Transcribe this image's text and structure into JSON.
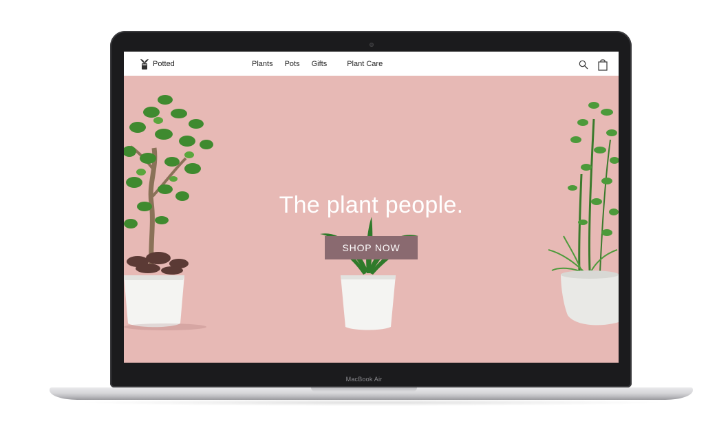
{
  "device": {
    "label": "MacBook Air"
  },
  "site": {
    "brand": "Potted",
    "nav": {
      "items": [
        "Plants",
        "Pots",
        "Gifts",
        "Plant Care"
      ]
    },
    "icons": {
      "search": "search-icon",
      "cart": "shopping-bag-icon"
    },
    "hero": {
      "title": "The plant people.",
      "cta_label": "SHOP NOW"
    },
    "colors": {
      "hero_background": "#e7b9b5",
      "cta_background": "#8a6a70",
      "leaf_green": "#3f8a2f",
      "pot_white": "#f4f4f2"
    }
  }
}
